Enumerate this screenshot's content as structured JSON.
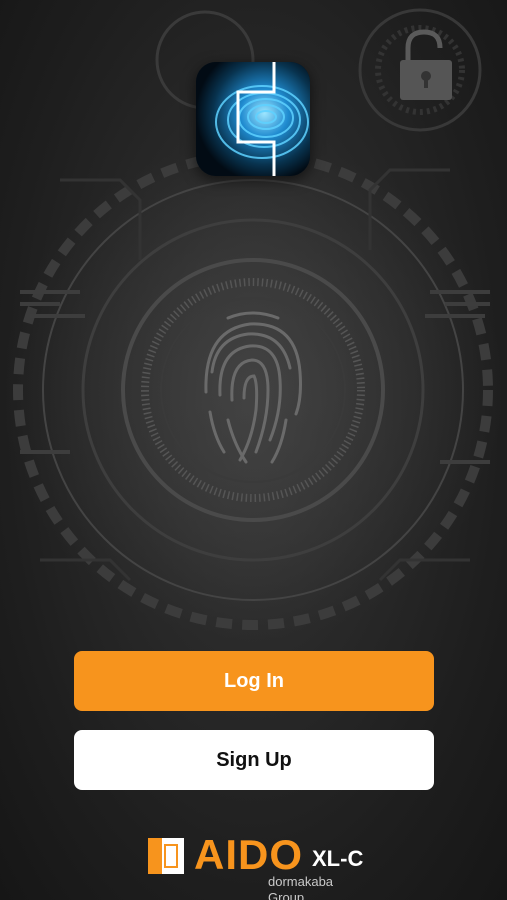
{
  "colors": {
    "accent": "#F7941D",
    "button_secondary_bg": "#FFFFFF",
    "background": "#222222"
  },
  "app_icon": {
    "icon": "fingerprint-lock-icon"
  },
  "actions": {
    "login_label": "Log In",
    "signup_label": "Sign Up"
  },
  "brand": {
    "mark_icon": "aido-bracket-icon",
    "name": "AIDO",
    "model": "XL-C",
    "group": "dormakaba Group"
  }
}
